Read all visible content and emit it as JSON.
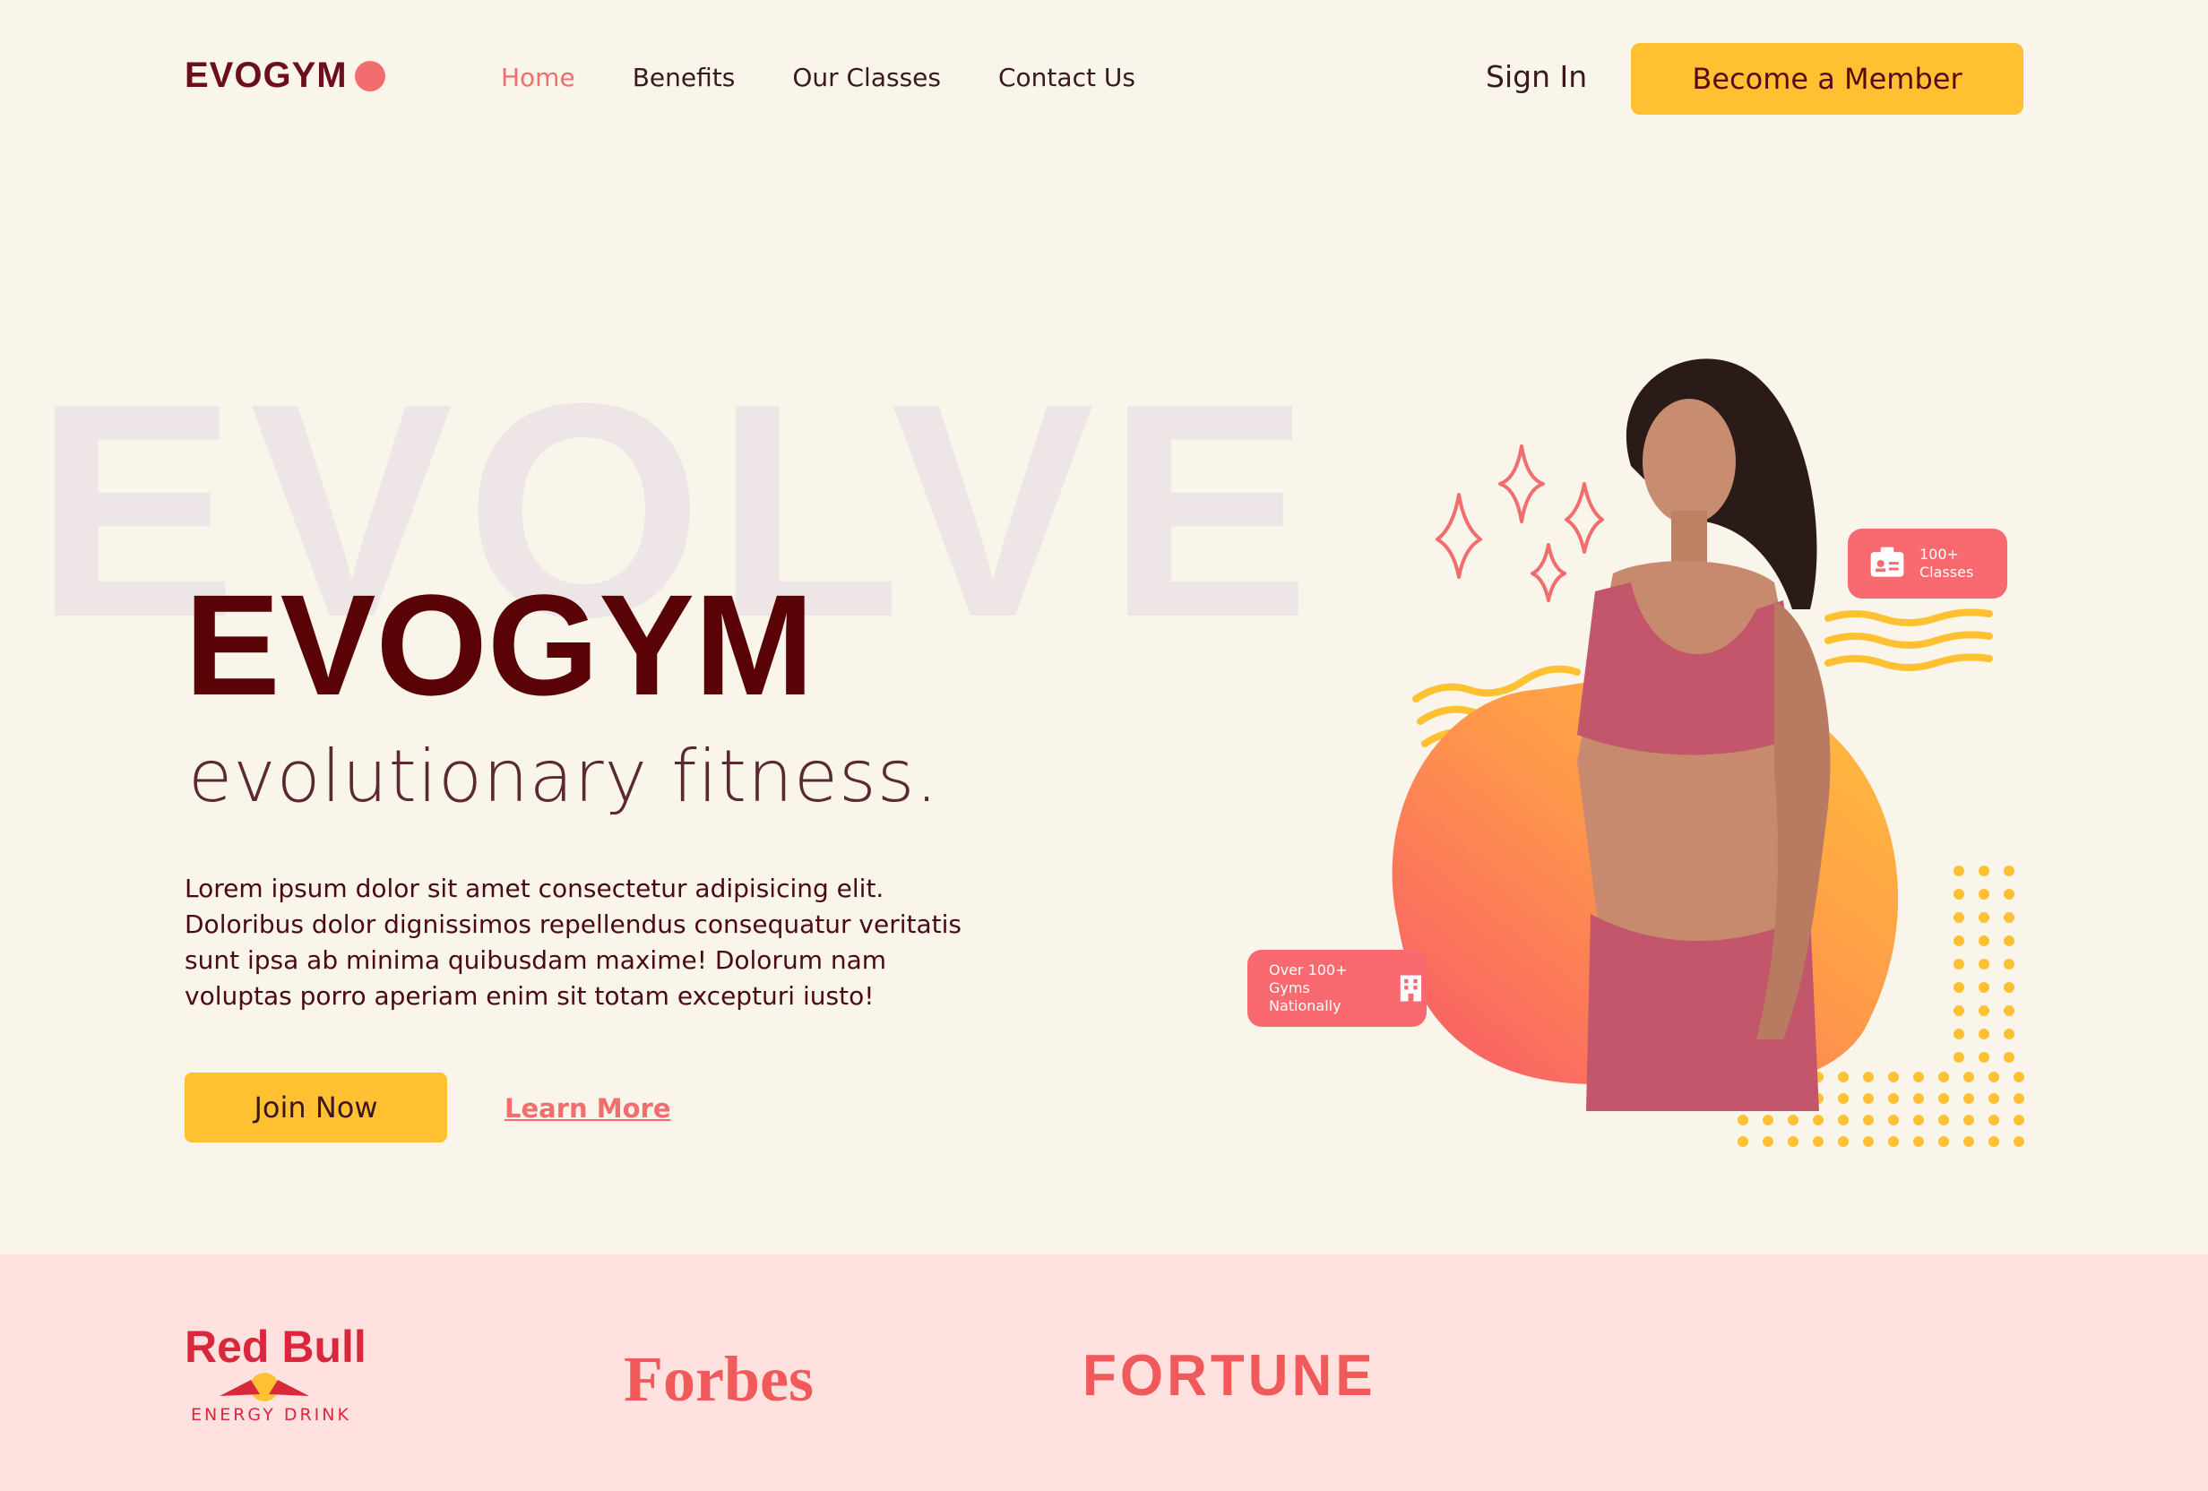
{
  "brand": {
    "name": "EVOGYM",
    "accent": "#f26d6d",
    "primary": "#5a0307",
    "button": "#ffc132"
  },
  "nav": {
    "items": [
      {
        "label": "Home",
        "active": true
      },
      {
        "label": "Benefits",
        "active": false
      },
      {
        "label": "Our Classes",
        "active": false
      },
      {
        "label": "Contact Us",
        "active": false
      }
    ],
    "sign_in": "Sign In",
    "cta": "Become a Member"
  },
  "hero": {
    "background_word": "EVOLVE",
    "title": "EVOGYM",
    "subtitle": "evolutionary fitness.",
    "text": "Lorem ipsum dolor sit amet consectetur adipisicing elit. Doloribus dolor dignissimos repellendus consequatur veritatis sunt ipsa ab minima quibusdam maxime! Dolorum nam voluptas porro aperiam enim sit totam excepturi iusto!",
    "primary_button": "Join Now",
    "secondary_link": "Learn More",
    "badge_classes_line1": "100+",
    "badge_classes_line2": "Classes",
    "badge_gyms_line1": "Over 100+",
    "badge_gyms_line2": "Gyms Nationally"
  },
  "sponsors": {
    "redbull": "Red Bull",
    "redbull_sub": "ENERGY DRINK",
    "forbes": "Forbes",
    "fortune": "FORTUNE"
  }
}
